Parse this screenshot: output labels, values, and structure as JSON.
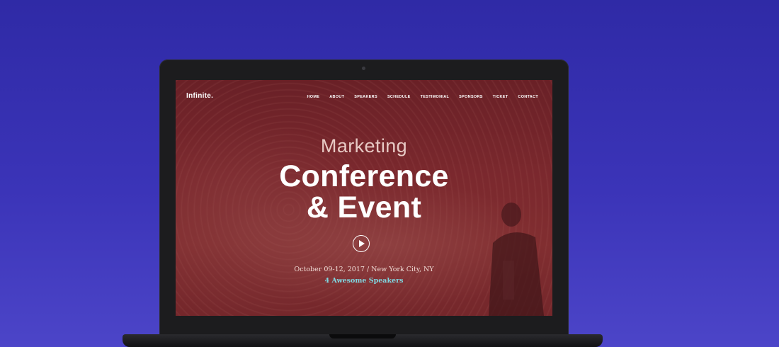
{
  "site": {
    "logo": "Infinite."
  },
  "nav": {
    "items": [
      "HOME",
      "ABOUT",
      "SPEAKERS",
      "SCHEDULE",
      "TESTIMONIAL",
      "SPONSORS",
      "TICKET",
      "CONTACT"
    ]
  },
  "hero": {
    "kicker": "Marketing",
    "title_line1": "Conference",
    "title_line2": "& Event",
    "date_location": "October 09-12, 2017 / New York City, NY",
    "speakers": "4 Awesome Speakers",
    "play_icon": "play-icon"
  },
  "colors": {
    "background": "#3b34b8",
    "overlay": "#7d2328",
    "accent": "#7fd6e0",
    "text": "#ffffff"
  }
}
